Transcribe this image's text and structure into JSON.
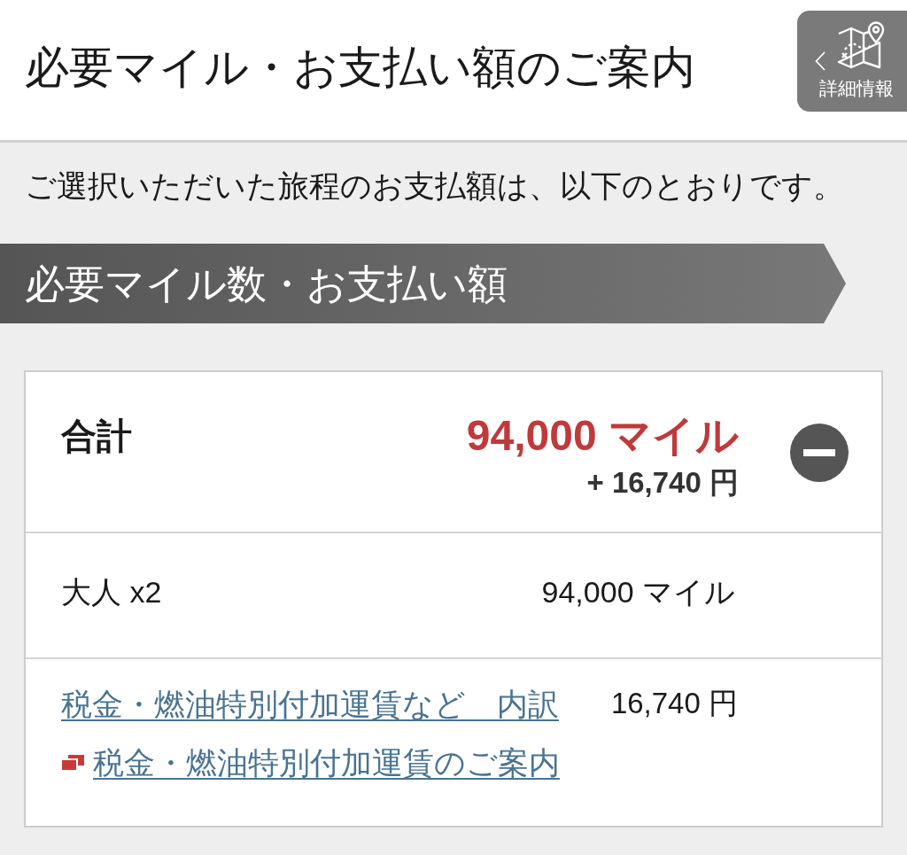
{
  "header": {
    "title": "必要マイル・お支払い額のご案内",
    "detail_button": {
      "label": "詳細情報"
    }
  },
  "intro": "ご選択いただいた旅程のお支払額は、以下のとおりです。",
  "section_banner": {
    "title": "必要マイル数・お支払い額"
  },
  "summary": {
    "total": {
      "label": "合計",
      "miles": "94,000 マイル",
      "payment": "+ 16,740 円",
      "expanded": true
    },
    "rows": [
      {
        "kind": "passenger",
        "label": "大人 x2",
        "value": "94,000 マイル"
      },
      {
        "kind": "tax",
        "link": "税金・燃油特別付加運賃など　内訳",
        "value": "16,740 円",
        "info_link": "税金・燃油特別付加運賃のご案内"
      }
    ]
  }
}
